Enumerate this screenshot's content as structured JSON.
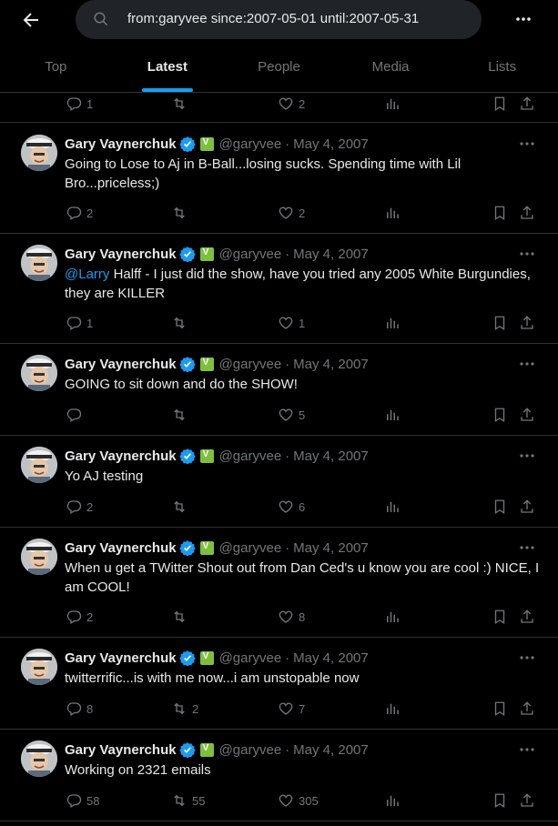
{
  "search": {
    "query": "from:garyvee since:2007-05-01 until:2007-05-31"
  },
  "tabs": [
    "Top",
    "Latest",
    "People",
    "Media",
    "Lists"
  ],
  "colors": {
    "accent": "#1d9bf0",
    "muted": "#71767b",
    "background": "#000000",
    "divider": "#2f3336"
  },
  "top_partial": {
    "replies": "1",
    "retweets": "",
    "likes": "2"
  },
  "tweets": [
    {
      "name": "Gary Vaynerchuk",
      "handle": "@garyvee",
      "sep": "·",
      "date": "May 4, 2007",
      "text": "Going to Lose to Aj in B-Ball...losing sucks. Spending time with Lil Bro...priceless;)",
      "replies": "2",
      "retweets": "",
      "likes": "2"
    },
    {
      "name": "Gary Vaynerchuk",
      "handle": "@garyvee",
      "sep": "·",
      "date": "May 4, 2007",
      "mention": "@Larry",
      "text": " Halff - I just did the show, have you tried any 2005 White Burgundies, they are KILLER",
      "replies": "1",
      "retweets": "",
      "likes": "1"
    },
    {
      "name": "Gary Vaynerchuk",
      "handle": "@garyvee",
      "sep": "·",
      "date": "May 4, 2007",
      "text": "GOING to sit down and do the SHOW!",
      "replies": "",
      "retweets": "",
      "likes": "5"
    },
    {
      "name": "Gary Vaynerchuk",
      "handle": "@garyvee",
      "sep": "·",
      "date": "May 4, 2007",
      "text": "Yo AJ testing",
      "replies": "2",
      "retweets": "",
      "likes": "6"
    },
    {
      "name": "Gary Vaynerchuk",
      "handle": "@garyvee",
      "sep": "·",
      "date": "May 4, 2007",
      "text": "When u get a TWitter Shout out from Dan Ced's u know you are cool :) NICE, I am COOL!",
      "replies": "2",
      "retweets": "",
      "likes": "8"
    },
    {
      "name": "Gary Vaynerchuk",
      "handle": "@garyvee",
      "sep": "·",
      "date": "May 4, 2007",
      "text": "twitterrific...is with me now...i am unstopable now",
      "replies": "8",
      "retweets": "2",
      "likes": "7"
    },
    {
      "name": "Gary Vaynerchuk",
      "handle": "@garyvee",
      "sep": "·",
      "date": "May 4, 2007",
      "text": "Working on 2321 emails",
      "replies": "58",
      "retweets": "55",
      "likes": "305"
    }
  ]
}
